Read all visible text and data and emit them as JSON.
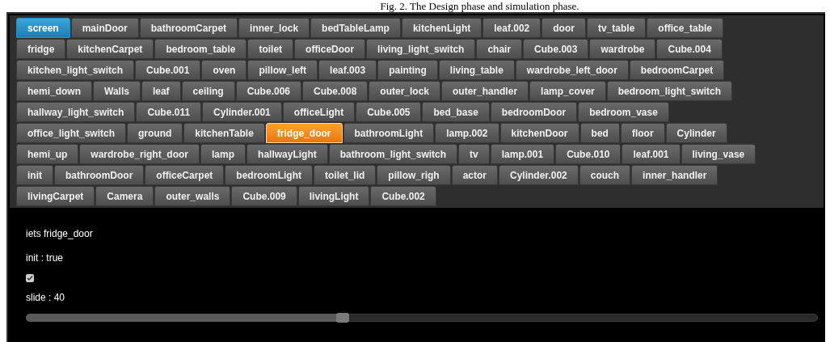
{
  "caption": "Fig. 2. The Design phase and simulation phase.",
  "button_rows": [
    [
      {
        "label": "screen",
        "active": true,
        "selected": false
      },
      {
        "label": "mainDoor",
        "active": false,
        "selected": false
      },
      {
        "label": "bathroomCarpet",
        "active": false,
        "selected": false
      },
      {
        "label": "inner_lock",
        "active": false,
        "selected": false
      },
      {
        "label": "bedTableLamp",
        "active": false,
        "selected": false
      },
      {
        "label": "kitchenLight",
        "active": false,
        "selected": false
      },
      {
        "label": "leaf.002",
        "active": false,
        "selected": false
      },
      {
        "label": "door",
        "active": false,
        "selected": false
      },
      {
        "label": "tv_table",
        "active": false,
        "selected": false
      },
      {
        "label": "office_table",
        "active": false,
        "selected": false
      }
    ],
    [
      {
        "label": "fridge",
        "active": false,
        "selected": false
      },
      {
        "label": "kitchenCarpet",
        "active": false,
        "selected": false
      },
      {
        "label": "bedroom_table",
        "active": false,
        "selected": false
      },
      {
        "label": "toilet",
        "active": false,
        "selected": false
      },
      {
        "label": "officeDoor",
        "active": false,
        "selected": false
      },
      {
        "label": "living_light_switch",
        "active": false,
        "selected": false
      },
      {
        "label": "chair",
        "active": false,
        "selected": false
      },
      {
        "label": "Cube.003",
        "active": false,
        "selected": false
      },
      {
        "label": "wardrobe",
        "active": false,
        "selected": false
      },
      {
        "label": "Cube.004",
        "active": false,
        "selected": false
      }
    ],
    [
      {
        "label": "kitchen_light_switch",
        "active": false,
        "selected": false
      },
      {
        "label": "Cube.001",
        "active": false,
        "selected": false
      },
      {
        "label": "oven",
        "active": false,
        "selected": false
      },
      {
        "label": "pillow_left",
        "active": false,
        "selected": false
      },
      {
        "label": "leaf.003",
        "active": false,
        "selected": false
      },
      {
        "label": "painting",
        "active": false,
        "selected": false
      },
      {
        "label": "living_table",
        "active": false,
        "selected": false
      },
      {
        "label": "wardrobe_left_door",
        "active": false,
        "selected": false
      },
      {
        "label": "bedroomCarpet",
        "active": false,
        "selected": false
      }
    ],
    [
      {
        "label": "hemi_down",
        "active": false,
        "selected": false
      },
      {
        "label": "Walls",
        "active": false,
        "selected": false
      },
      {
        "label": "leaf",
        "active": false,
        "selected": false
      },
      {
        "label": "ceiling",
        "active": false,
        "selected": false
      },
      {
        "label": "Cube.006",
        "active": false,
        "selected": false
      },
      {
        "label": "Cube.008",
        "active": false,
        "selected": false
      },
      {
        "label": "outer_lock",
        "active": false,
        "selected": false
      },
      {
        "label": "outer_handler",
        "active": false,
        "selected": false
      },
      {
        "label": "lamp_cover",
        "active": false,
        "selected": false
      },
      {
        "label": "bedroom_light_switch",
        "active": false,
        "selected": false
      }
    ],
    [
      {
        "label": "hallway_light_switch",
        "active": false,
        "selected": false
      },
      {
        "label": "Cube.011",
        "active": false,
        "selected": false
      },
      {
        "label": "Cylinder.001",
        "active": false,
        "selected": false
      },
      {
        "label": "officeLight",
        "active": false,
        "selected": false
      },
      {
        "label": "Cube.005",
        "active": false,
        "selected": false
      },
      {
        "label": "bed_base",
        "active": false,
        "selected": false
      },
      {
        "label": "bedroomDoor",
        "active": false,
        "selected": false
      },
      {
        "label": "bedroom_vase",
        "active": false,
        "selected": false
      }
    ],
    [
      {
        "label": "office_light_switch",
        "active": false,
        "selected": false
      },
      {
        "label": "ground",
        "active": false,
        "selected": false
      },
      {
        "label": "kitchenTable",
        "active": false,
        "selected": false
      },
      {
        "label": "fridge_door",
        "active": false,
        "selected": true
      },
      {
        "label": "bathroomLight",
        "active": false,
        "selected": false
      },
      {
        "label": "lamp.002",
        "active": false,
        "selected": false
      },
      {
        "label": "kitchenDoor",
        "active": false,
        "selected": false
      },
      {
        "label": "bed",
        "active": false,
        "selected": false
      },
      {
        "label": "floor",
        "active": false,
        "selected": false
      },
      {
        "label": "Cylinder",
        "active": false,
        "selected": false
      }
    ],
    [
      {
        "label": "hemi_up",
        "active": false,
        "selected": false
      },
      {
        "label": "wardrobe_right_door",
        "active": false,
        "selected": false
      },
      {
        "label": "lamp",
        "active": false,
        "selected": false
      },
      {
        "label": "hallwayLight",
        "active": false,
        "selected": false
      },
      {
        "label": "bathroom_light_switch",
        "active": false,
        "selected": false
      },
      {
        "label": "tv",
        "active": false,
        "selected": false
      },
      {
        "label": "lamp.001",
        "active": false,
        "selected": false
      },
      {
        "label": "Cube.010",
        "active": false,
        "selected": false
      },
      {
        "label": "leaf.001",
        "active": false,
        "selected": false
      },
      {
        "label": "living_vase",
        "active": false,
        "selected": false
      }
    ],
    [
      {
        "label": "init",
        "active": false,
        "selected": false
      },
      {
        "label": "bathroomDoor",
        "active": false,
        "selected": false
      },
      {
        "label": "officeCarpet",
        "active": false,
        "selected": false
      },
      {
        "label": "bedroomLight",
        "active": false,
        "selected": false
      },
      {
        "label": "toilet_lid",
        "active": false,
        "selected": false
      },
      {
        "label": "pillow_righ",
        "active": false,
        "selected": false
      },
      {
        "label": "actor",
        "active": false,
        "selected": false
      },
      {
        "label": "Cylinder.002",
        "active": false,
        "selected": false
      },
      {
        "label": "couch",
        "active": false,
        "selected": false
      },
      {
        "label": "inner_handler",
        "active": false,
        "selected": false
      }
    ],
    [
      {
        "label": "livingCarpet",
        "active": false,
        "selected": false
      },
      {
        "label": "Camera",
        "active": false,
        "selected": false
      },
      {
        "label": "outer_walls",
        "active": false,
        "selected": false
      },
      {
        "label": "Cube.009",
        "active": false,
        "selected": false
      },
      {
        "label": "livingLight",
        "active": false,
        "selected": false
      },
      {
        "label": "Cube.002",
        "active": false,
        "selected": false
      }
    ]
  ],
  "panel": {
    "heading": "iets fridge_door",
    "init_label": "init : true",
    "init_checkbox": {
      "checked": true
    },
    "slide_label": "slide : 40",
    "slider": {
      "level": 0.4
    }
  }
}
